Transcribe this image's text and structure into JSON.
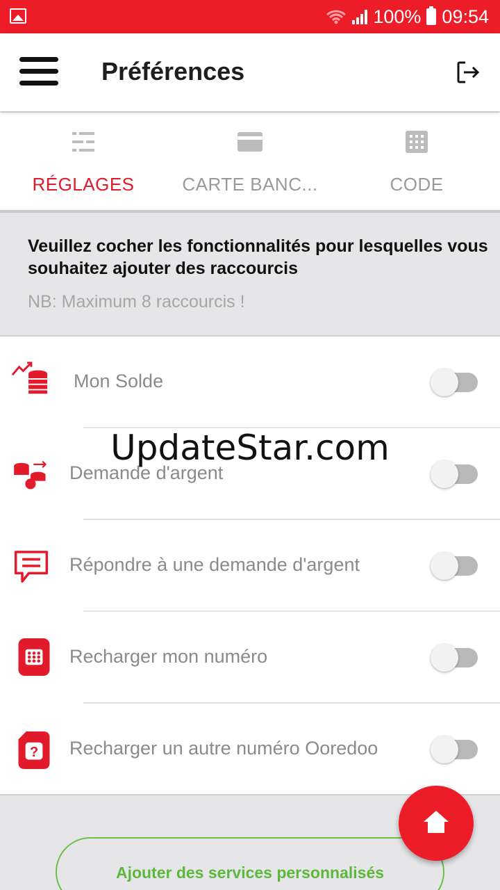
{
  "status_bar": {
    "battery": "100%",
    "time": "09:54",
    "icons": [
      "image-icon",
      "wifi-icon",
      "signal-icon",
      "battery-icon"
    ]
  },
  "app_bar": {
    "title": "Préférences",
    "menu_icon": "hamburger-menu-icon",
    "logout_icon": "logout-icon"
  },
  "tabs": [
    {
      "label": "RÉGLAGES",
      "icon": "sliders-icon",
      "active": true
    },
    {
      "label": "CARTE BANC...",
      "icon": "credit-card-icon",
      "active": false
    },
    {
      "label": "CODE",
      "icon": "keypad-icon",
      "active": false
    }
  ],
  "intro": {
    "text": "Veuillez cocher les fonctionnalités pour lesquelles vous souhaitez ajouter des raccourcis",
    "note": "NB: Maximum 8 raccourcis !"
  },
  "shortcuts": [
    {
      "label": "Mon Solde",
      "icon": "balance-coins-icon",
      "enabled": false
    },
    {
      "label": "Demande d'argent",
      "icon": "money-request-icon",
      "enabled": false
    },
    {
      "label": "Répondre à une demande d'argent",
      "icon": "chat-reply-icon",
      "enabled": false
    },
    {
      "label": "Recharger mon numéro",
      "icon": "sim-recharge-icon",
      "enabled": false
    },
    {
      "label": "Recharger un autre numéro Ooredoo",
      "icon": "sim-question-icon",
      "enabled": false
    }
  ],
  "watermark": "UpdateStar.com",
  "add_button": "Ajouter des services personnalisés",
  "fab": {
    "icon": "home-icon"
  },
  "colors": {
    "brand_red": "#ec1c29",
    "active_tab": "#e11b2b",
    "add_button_green": "#5cb83a"
  }
}
